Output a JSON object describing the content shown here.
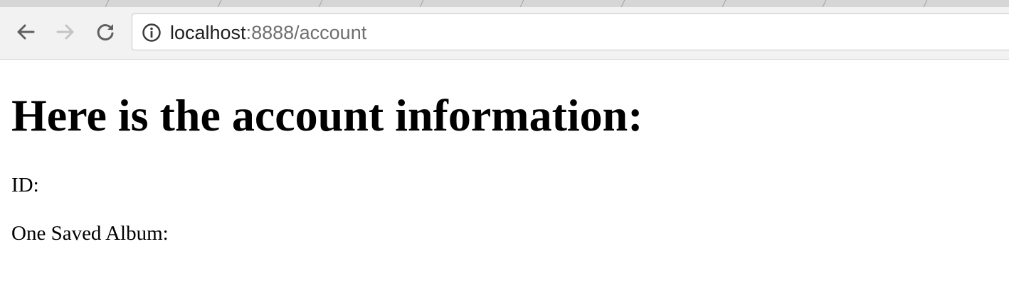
{
  "browser": {
    "address": {
      "host": "localhost",
      "rest": ":8888/account"
    },
    "icons": {
      "back": "arrow-left-icon",
      "forward": "arrow-right-icon",
      "reload": "reload-icon",
      "site_info": "info-circle-icon"
    },
    "forward_enabled": false
  },
  "page": {
    "heading": "Here is the account information:",
    "id_label": "ID:",
    "album_label": "One Saved Album:"
  }
}
